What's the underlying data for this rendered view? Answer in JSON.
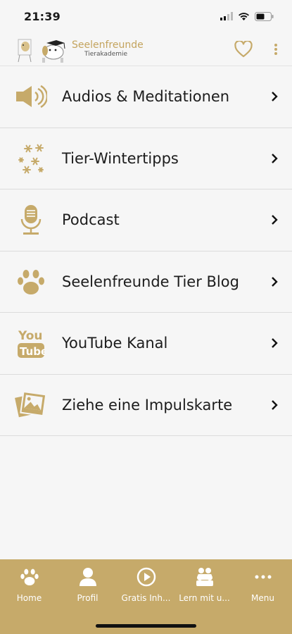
{
  "status": {
    "time": "21:39"
  },
  "header": {
    "logo_title": "Seelenfreunde",
    "logo_subtitle": "Tierakademie",
    "accent": "#c6aa6a"
  },
  "menu": [
    {
      "label": "Audios & Meditationen",
      "icon": "speaker-icon"
    },
    {
      "label": "Tier-Wintertipps",
      "icon": "snowflakes-icon"
    },
    {
      "label": "Podcast",
      "icon": "microphone-icon"
    },
    {
      "label": "Seelenfreunde Tier Blog",
      "icon": "paw-icon"
    },
    {
      "label": "YouTube Kanal",
      "icon": "youtube-icon"
    },
    {
      "label": "Ziehe eine Impulskarte",
      "icon": "photos-icon"
    }
  ],
  "tabbar": {
    "tabs": [
      {
        "label": "Home",
        "icon": "paw-icon"
      },
      {
        "label": "Profil",
        "icon": "person-icon"
      },
      {
        "label": "Gratis Inh...",
        "icon": "play-icon"
      },
      {
        "label": "Lern mit u...",
        "icon": "group-icon"
      },
      {
        "label": "Menu",
        "icon": "more-icon"
      }
    ]
  }
}
